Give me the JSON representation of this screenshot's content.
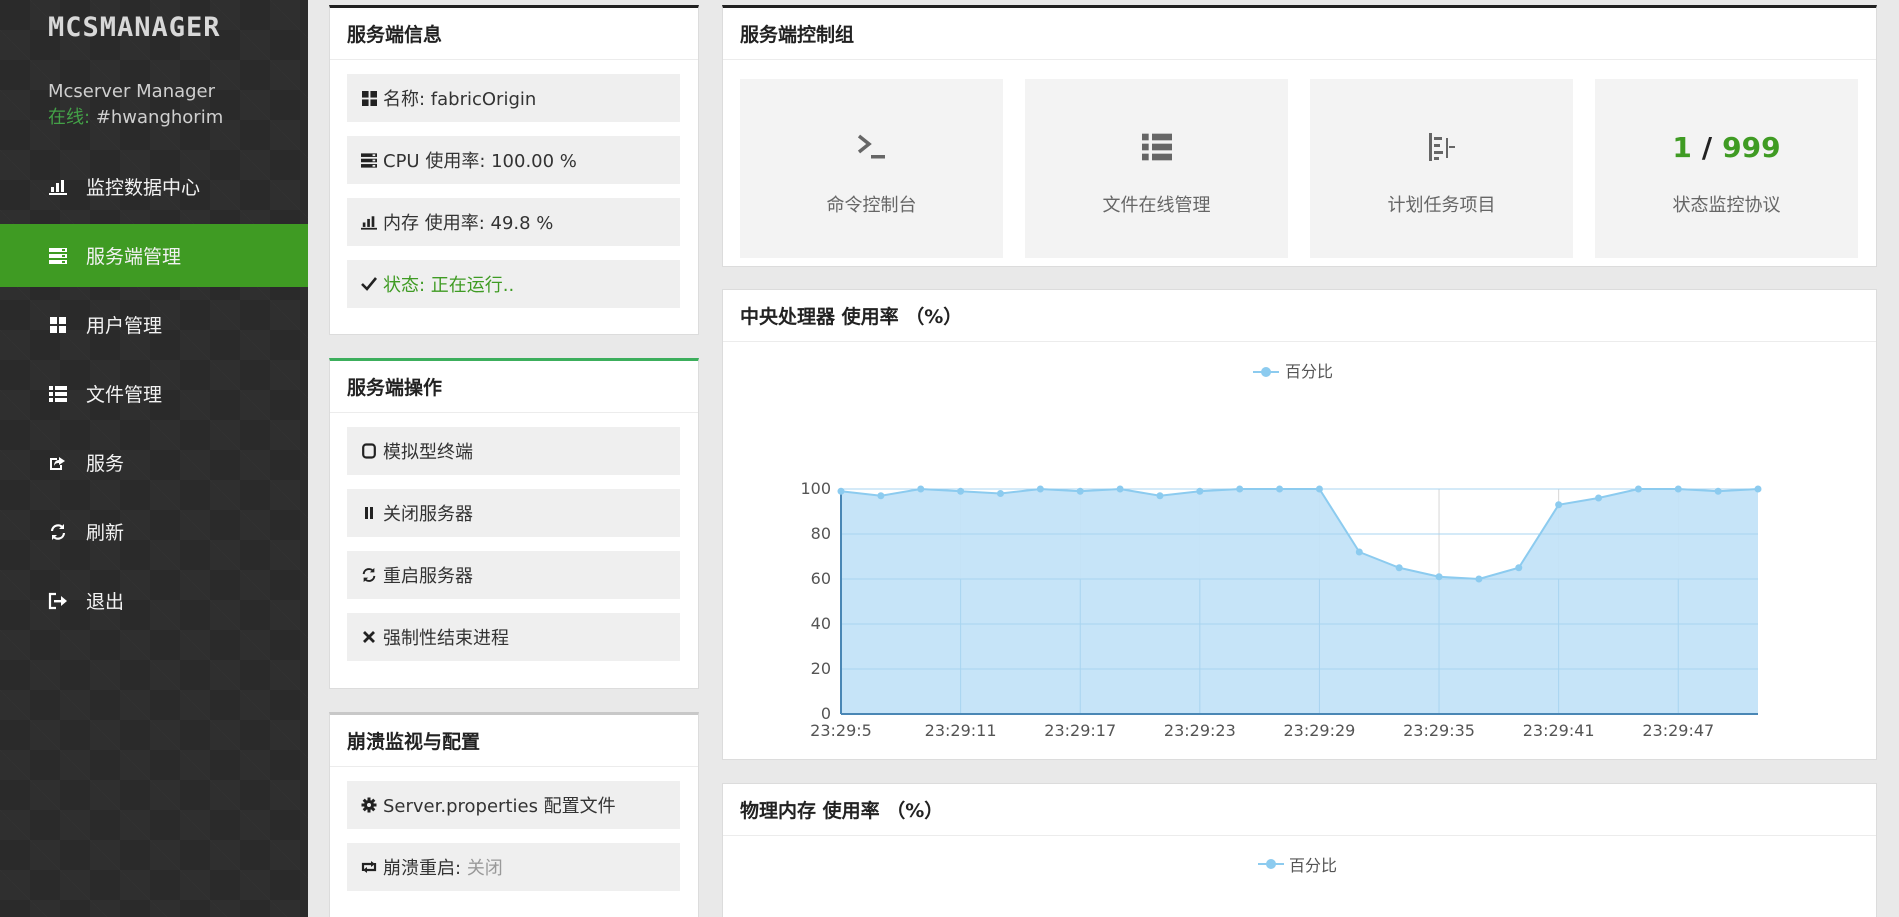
{
  "sidebar": {
    "logo": "MCSMANAGER",
    "app_name": "Mcserver Manager",
    "online_label": "在线:",
    "username": "#hwanghorim",
    "items": [
      {
        "label": "监控数据中心",
        "icon": "bar-chart-icon"
      },
      {
        "label": "服务端管理",
        "icon": "server-icon",
        "active": true
      },
      {
        "label": "用户管理",
        "icon": "grid-icon"
      },
      {
        "label": "文件管理",
        "icon": "list-icon"
      },
      {
        "label": "服务",
        "icon": "export-icon"
      },
      {
        "label": "刷新",
        "icon": "refresh-icon"
      },
      {
        "label": "退出",
        "icon": "logout-icon"
      }
    ]
  },
  "server_info": {
    "title": "服务端信息",
    "name": "名称: fabricOrigin",
    "cpu": "CPU 使用率: 100.00 %",
    "memory": "内存 使用率: 49.8 %",
    "status": "状态: 正在运行.."
  },
  "server_ops": {
    "title": "服务端操作",
    "terminal": "模拟型终端",
    "stop": "关闭服务器",
    "restart": "重启服务器",
    "kill": "强制性结束进程"
  },
  "crash": {
    "title": "崩溃监视与配置",
    "properties": "Server.properties 配置文件",
    "crash_restart_label": "崩溃重启:",
    "crash_restart_value": "关闭"
  },
  "control": {
    "title": "服务端控制组",
    "console": "命令控制台",
    "files": "文件在线管理",
    "schedule": "计划任务项目",
    "players_online": "1",
    "players_sep": "/",
    "players_max": "999",
    "status_protocol": "状态监控协议"
  },
  "colors": {
    "accent_green": "#3f9b23",
    "chart_fill": "#c3e3f8",
    "chart_line": "#8ccbef"
  },
  "cpu_chart": {
    "title": "中央处理器 使用率 （%）"
  },
  "mem_chart": {
    "title": "物理内存 使用率 （%）",
    "legend": "百分比"
  },
  "chart_data": {
    "type": "area",
    "title": "中央处理器 使用率 （%）",
    "legend": [
      "百分比"
    ],
    "x_tick_labels": [
      "23:29:5",
      "23:29:11",
      "23:29:17",
      "23:29:23",
      "23:29:29",
      "23:29:35",
      "23:29:41",
      "23:29:47"
    ],
    "y_tick_labels": [
      "0",
      "20",
      "40",
      "60",
      "80",
      "100"
    ],
    "ylim": [
      0,
      100
    ],
    "grid": true,
    "series": [
      {
        "name": "百分比",
        "values": [
          99,
          97,
          100,
          99,
          98,
          100,
          99,
          100,
          97,
          99,
          100,
          100,
          100,
          72,
          65,
          61,
          60,
          65,
          93,
          96,
          100,
          100,
          99,
          100
        ]
      }
    ]
  }
}
